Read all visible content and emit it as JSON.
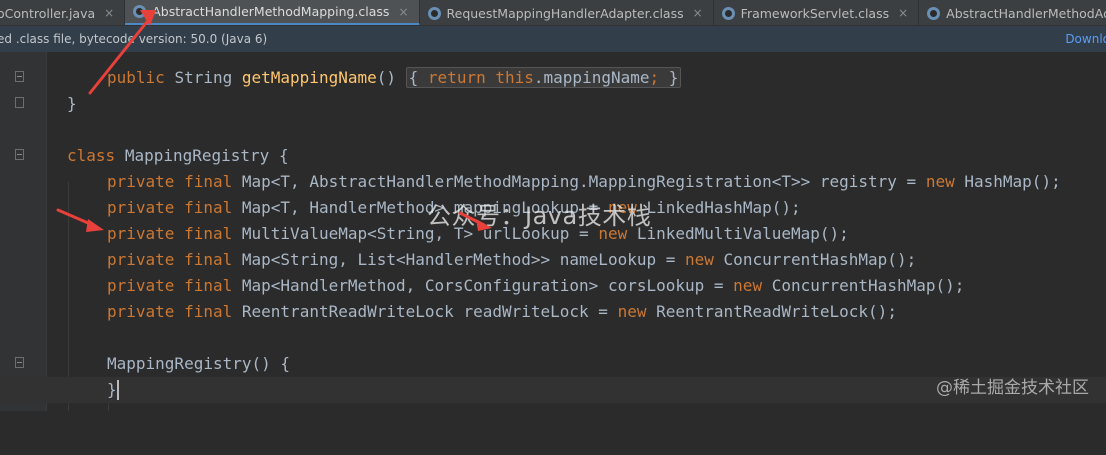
{
  "editor_tabs": [
    {
      "label": "oController.java",
      "active": false
    },
    {
      "label": "AbstractHandlerMethodMapping.class",
      "active": true
    },
    {
      "label": "RequestMappingHandlerAdapter.class",
      "active": false
    },
    {
      "label": "FrameworkServlet.class",
      "active": false
    },
    {
      "label": "AbstractHandlerMethodAdapter.class",
      "active": false
    }
  ],
  "tab_close_glyph": "×",
  "info_bar": {
    "message": "ed .class file, bytecode version: 50.0 (Java 6)",
    "link": "Downlo"
  },
  "code": {
    "l1": {
      "kw": "public",
      "type": "String",
      "fn": "getMappingName",
      "paren": "()",
      "open": "{",
      "ret": "return",
      "this": "this",
      ".": ".",
      "field": "mappingName",
      "semi": ";",
      "close": "}"
    },
    "l2": "}",
    "l4": {
      "kw": "class",
      "name": "MappingRegistry {"
    },
    "l5": {
      "kw1": "private",
      "kw2": "final",
      "body": "Map<T, AbstractHandlerMethodMapping.MappingRegistration<T>> registry = ",
      "new": "new",
      "tail": "HashMap();"
    },
    "l6": {
      "kw1": "private",
      "kw2": "final",
      "body": "Map<T, HandlerMethod> mappingLookup = ",
      "new": "new",
      "tail": "LinkedHashMap();"
    },
    "l7": {
      "kw1": "private",
      "kw2": "final",
      "body": "MultiValueMap<String, T> urlLookup = ",
      "new": "new",
      "tail": "LinkedMultiValueMap();"
    },
    "l8": {
      "kw1": "private",
      "kw2": "final",
      "body": "Map<String, List<HandlerMethod>> nameLookup = ",
      "new": "new",
      "tail": "ConcurrentHashMap();"
    },
    "l9": {
      "kw1": "private",
      "kw2": "final",
      "body": "Map<HandlerMethod, CorsConfiguration> corsLookup = ",
      "new": "new",
      "tail": "ConcurrentHashMap();"
    },
    "l10": {
      "kw1": "private",
      "kw2": "final",
      "body": "ReentrantReadWriteLock readWriteLock = ",
      "new": "new",
      "tail": "ReentrantReadWriteLock();"
    },
    "l12": {
      "fn": "MappingRegistry",
      "rest": "() {"
    },
    "l13": "}"
  },
  "watermark": "公众号：Java技术栈",
  "corner_watermark": "@稀土掘金技术社区",
  "colors": {
    "keyword": "#cc7832",
    "identifier": "#a9b7c6",
    "method": "#ffc66d",
    "active_tab_underline": "#4a88c7",
    "annotation_arrow": "#e8403a"
  }
}
